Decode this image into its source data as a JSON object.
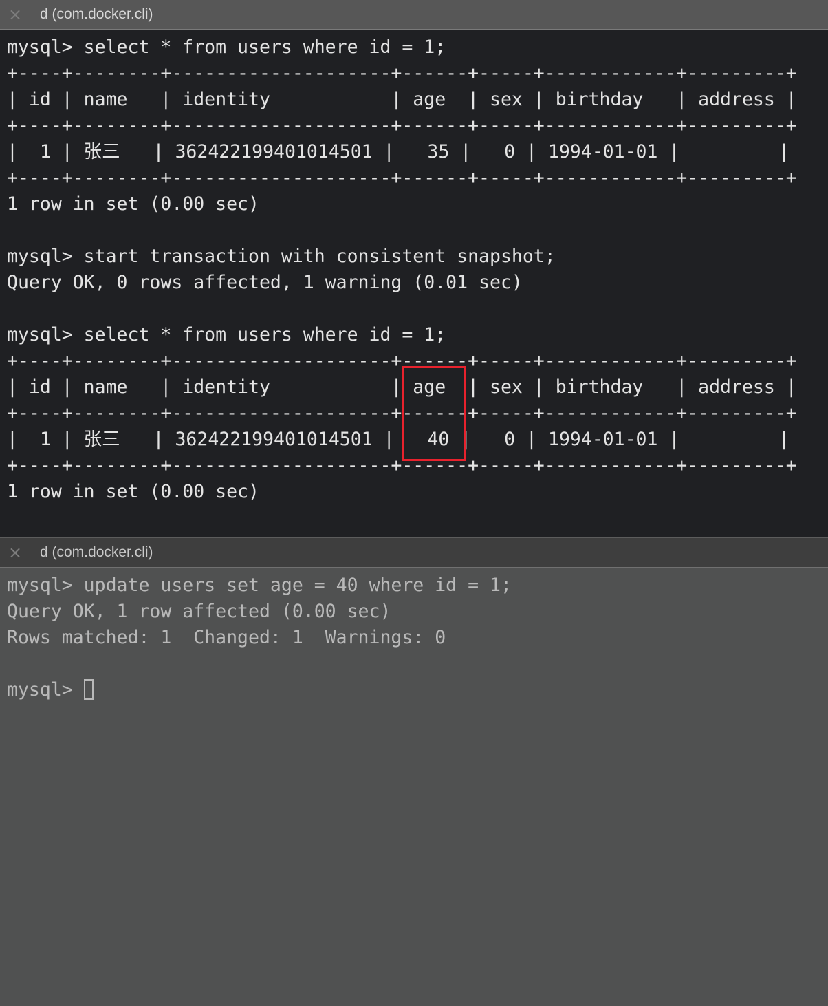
{
  "panes": [
    {
      "tab": {
        "close_icon": "×",
        "title": "d (com.docker.cli)"
      },
      "lines": [
        "mysql> select * from users where id = 1;",
        "+----+--------+--------------------+------+-----+------------+---------+",
        "| id | name   | identity           | age  | sex | birthday   | address |",
        "+----+--------+--------------------+------+-----+------------+---------+",
        "|  1 | 张三   | 362422199401014501 |   35 |   0 | 1994-01-01 |         |",
        "+----+--------+--------------------+------+-----+------------+---------+",
        "1 row in set (0.00 sec)",
        "",
        "mysql> start transaction with consistent snapshot;",
        "Query OK, 0 rows affected, 1 warning (0.01 sec)",
        "",
        "mysql> select * from users where id = 1;",
        "+----+--------+--------------------+------+-----+------------+---------+",
        "| id | name   | identity           | age  | sex | birthday   | address |",
        "+----+--------+--------------------+------+-----+------------+---------+",
        "|  1 | 张三   | 362422199401014501 |   40 |   0 | 1994-01-01 |         |",
        "+----+--------+--------------------+------+-----+------------+---------+",
        "1 row in set (0.00 sec)"
      ],
      "highlight": {
        "label": "age column highlighted",
        "color": "#e8222d"
      }
    },
    {
      "tab": {
        "close_icon": "×",
        "title": "d (com.docker.cli)"
      },
      "lines": [
        "mysql> update users set age = 40 where id = 1;",
        "Query OK, 1 row affected (0.00 sec)",
        "Rows matched: 1  Changed: 1  Warnings: 0",
        ""
      ],
      "prompt": "mysql> "
    }
  ]
}
